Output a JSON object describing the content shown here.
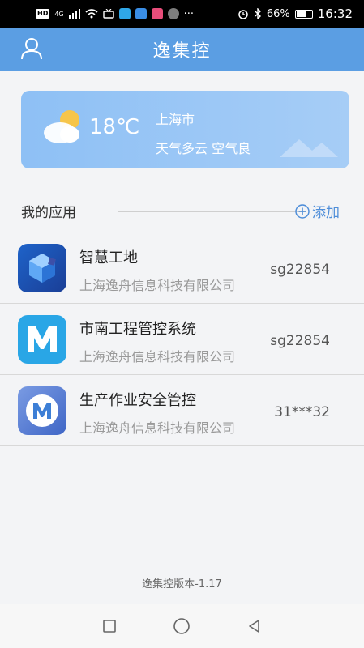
{
  "status_bar": {
    "left_tags": [
      "HD",
      "4G"
    ],
    "battery": "66%",
    "time": "16:32",
    "icons": [
      "hd-icon",
      "signal-icon",
      "wifi-icon",
      "tv-icon",
      "app-q-icon",
      "app-arrow-icon",
      "app-flower-icon",
      "app-compass-icon",
      "more-dots-icon",
      "alarm-icon",
      "bluetooth-icon",
      "battery-icon"
    ],
    "dots": "···"
  },
  "header": {
    "title": "逸集控",
    "left_icon": "user-icon",
    "background": "#5b9ee3"
  },
  "weather": {
    "temperature": "18℃",
    "city": "上海市",
    "description": "天气多云 空气良",
    "icon": "partly-cloudy-icon"
  },
  "apps_section": {
    "title": "我的应用",
    "add_label": "添加"
  },
  "apps": [
    {
      "name": "智慧工地",
      "company": "上海逸舟信息科技有限公司",
      "account": "sg22854",
      "logo": "cube-logo-icon"
    },
    {
      "name": "市南工程管控系统",
      "company": "上海逸舟信息科技有限公司",
      "account": "sg22854",
      "logo": "m-logo-icon"
    },
    {
      "name": "生产作业安全管控",
      "company": "上海逸舟信息科技有限公司",
      "account": "31***32",
      "logo": "m-circle-logo-icon"
    }
  ],
  "footer": {
    "version": "逸集控版本-1.17"
  },
  "nav": {
    "items": [
      "recent-apps-icon",
      "home-icon",
      "back-icon"
    ]
  }
}
